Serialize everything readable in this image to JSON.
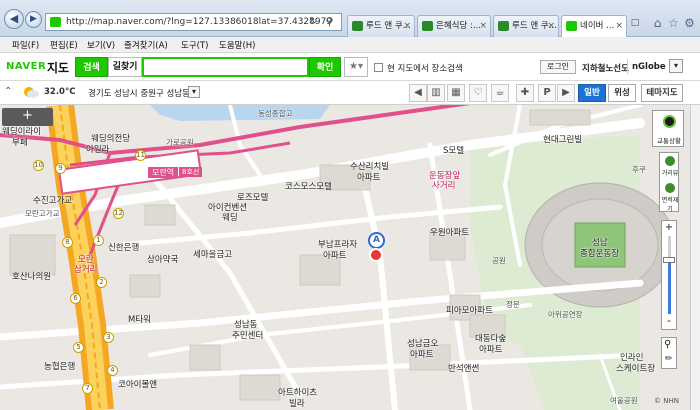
{
  "browser": {
    "url": "http://map.naver.com/?lng=127.13386018lat=37.4328979",
    "tabs": [
      {
        "label": "루드 앤 쿠...",
        "active": false
      },
      {
        "label": "은혜식당 :...",
        "active": false
      },
      {
        "label": "루드 앤 쿠...",
        "active": false
      },
      {
        "label": "네이버 ...",
        "active": true
      }
    ],
    "menu": [
      "파일(F)",
      "편집(E)",
      "보기(V)",
      "즐겨찾기(A)",
      "도구(T)",
      "도움말(H)"
    ]
  },
  "naver": {
    "logo": "NAVER",
    "product": "지도",
    "search_tab": "검색",
    "directions_tab": "길찾기",
    "search_value": "",
    "confirm_button": "확인",
    "favorites_icon": "star-icon",
    "checkbox_label": "현 지도에서 장소검색",
    "login_button": "로그인",
    "subway_link": "지하철노선도",
    "nglobe_link": "nGlobe"
  },
  "info": {
    "temperature": "32.0°C",
    "location": "경기도 성남시 중원구 성남동",
    "modes": [
      "일반",
      "위성",
      "테마지도"
    ],
    "active_mode": "일반",
    "tool_icons": [
      "bus-icon",
      "subway-icon",
      "restaurant-icon",
      "cafe-icon",
      "hospital-icon",
      "parking-icon"
    ]
  },
  "controls": {
    "traffic": "교통상황",
    "distance": "거리뷰",
    "area": "면적재기",
    "zoom_in": "+",
    "zoom_out": "-",
    "expand": "+"
  },
  "map": {
    "station_name": "모란역",
    "station_line": "8호선",
    "marker_letter": "A",
    "labels": [
      {
        "text": "웨딩이라이"
      },
      {
        "text": "부페"
      },
      {
        "text": "웨딩의전당"
      },
      {
        "text": "아일라"
      },
      {
        "text": "가로공원"
      },
      {
        "text": "동성종합고"
      },
      {
        "text": "현대그린빌"
      },
      {
        "text": "수산리치빌"
      },
      {
        "text": "아파트"
      },
      {
        "text": "S모텔"
      },
      {
        "text": "코스모스모텔"
      },
      {
        "text": "로즈모텔"
      },
      {
        "text": "아이컨벤션"
      },
      {
        "text": "웨딩"
      },
      {
        "text": "운동장앞"
      },
      {
        "text": "사거리"
      },
      {
        "text": "수진고가교"
      },
      {
        "text": "모란고가교"
      },
      {
        "text": "신한은행"
      },
      {
        "text": "상아약국"
      },
      {
        "text": "세마을금고"
      },
      {
        "text": "부남프라자"
      },
      {
        "text": "아파트"
      },
      {
        "text": "우원아파트"
      },
      {
        "text": "호산나의원"
      },
      {
        "text": "모란"
      },
      {
        "text": "삼거리"
      },
      {
        "text": "성남"
      },
      {
        "text": "종합운동장"
      },
      {
        "text": "공원"
      },
      {
        "text": "M타워"
      },
      {
        "text": "피아모아파트"
      },
      {
        "text": "아위공연장"
      },
      {
        "text": "정문"
      },
      {
        "text": "성남동"
      },
      {
        "text": "주민센터"
      },
      {
        "text": "대동다숲"
      },
      {
        "text": "아파트"
      },
      {
        "text": "성남금오"
      },
      {
        "text": "아파트"
      },
      {
        "text": "농협은행"
      },
      {
        "text": "코아이몰앤"
      },
      {
        "text": "반석앤썬"
      },
      {
        "text": "아트하이츠"
      },
      {
        "text": "빌라"
      },
      {
        "text": "인라인"
      },
      {
        "text": "스케이트장"
      },
      {
        "text": "후쿠"
      },
      {
        "text": "여울공원"
      }
    ],
    "exits": [
      "9",
      "11",
      "12",
      "8",
      "1",
      "2",
      "3",
      "4",
      "5",
      "6",
      "7",
      "10"
    ],
    "copyright": "© NHN"
  }
}
